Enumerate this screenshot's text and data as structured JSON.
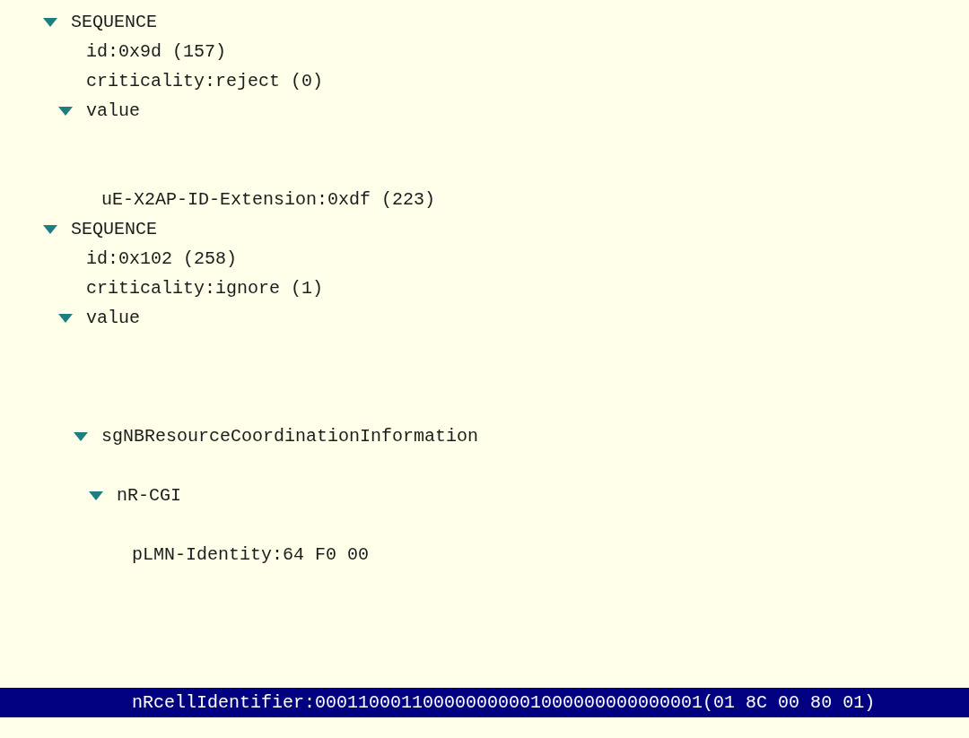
{
  "tree": [
    {
      "label": "SEQUENCE",
      "expanded": true,
      "selected": false,
      "children": [
        {
          "label": "id:0x9d (157)",
          "selected": false
        },
        {
          "label": "criticality:reject (0)",
          "selected": false
        },
        {
          "label": "value",
          "expanded": true,
          "selected": false,
          "children": [
            {
              "label": "uE-X2AP-ID-Extension:0xdf (223)",
              "selected": false
            }
          ]
        }
      ]
    },
    {
      "label": "SEQUENCE",
      "expanded": true,
      "selected": false,
      "children": [
        {
          "label": "id:0x102 (258)",
          "selected": false
        },
        {
          "label": "criticality:ignore (1)",
          "selected": false
        },
        {
          "label": "value",
          "expanded": true,
          "selected": false,
          "children": [
            {
              "label": "sgNBResourceCoordinationInformation",
              "expanded": true,
              "selected": false,
              "children": [
                {
                  "label": "nR-CGI",
                  "expanded": true,
                  "selected": false,
                  "children": [
                    {
                      "label": "pLMN-Identity:64 F0 00",
                      "selected": false
                    },
                    {
                      "label": "nRcellIdentifier:000110001100000000001000000000000001(01 8C 00 80 01)",
                      "selected": true
                    }
                  ]
                }
              ]
            }
          ]
        }
      ]
    }
  ]
}
